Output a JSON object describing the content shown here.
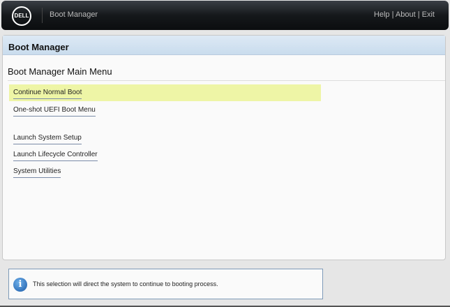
{
  "header": {
    "logo": "DELL",
    "title": "Boot Manager",
    "links": [
      "Help",
      "About",
      "Exit"
    ],
    "separator": " | "
  },
  "panel": {
    "title": "Boot Manager",
    "subtitle": "Boot Manager Main Menu",
    "items": [
      "Continue Normal Boot",
      "One-shot UEFI Boot Menu",
      "Launch System Setup",
      "Launch Lifecycle Controller",
      "System Utilities"
    ]
  },
  "info": {
    "text": "This selection will direct the system to continue to booting process.",
    "icon": "info-icon"
  }
}
